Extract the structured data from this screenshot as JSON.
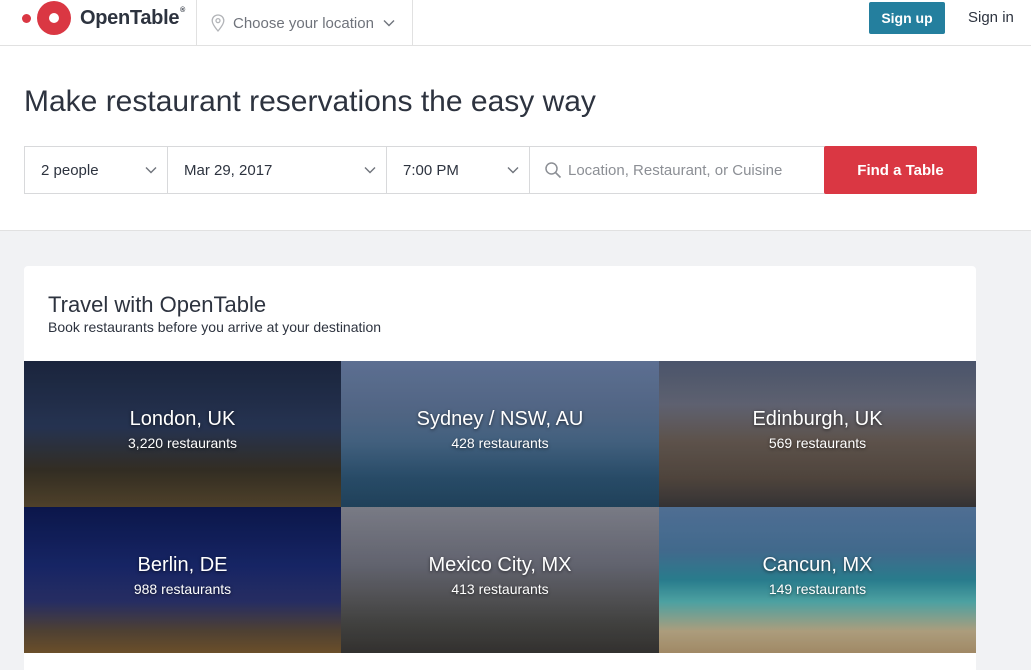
{
  "header": {
    "logo_text": "OpenTable",
    "logo_mark": "®",
    "location_label": "Choose your location",
    "signup_label": "Sign up",
    "signin_label": "Sign in"
  },
  "search": {
    "title": "Make restaurant reservations the easy way",
    "party_size": "2 people",
    "date": "Mar 29, 2017",
    "time": "7:00 PM",
    "query_placeholder": "Location, Restaurant, or Cuisine",
    "find_label": "Find a Table"
  },
  "travel": {
    "title": "Travel with OpenTable",
    "subtitle": "Book restaurants before you arrive at your destination",
    "cities": [
      {
        "name": "London, UK",
        "count": "3,220 restaurants"
      },
      {
        "name": "Sydney / NSW, AU",
        "count": "428 restaurants"
      },
      {
        "name": "Edinburgh, UK",
        "count": "569 restaurants"
      },
      {
        "name": "Berlin, DE",
        "count": "988 restaurants"
      },
      {
        "name": "Mexico City, MX",
        "count": "413 restaurants"
      },
      {
        "name": "Cancun, MX",
        "count": "149 restaurants"
      }
    ]
  },
  "colors": {
    "brand_red": "#da3743",
    "signup_teal": "#247f9e",
    "text": "#2d333f"
  },
  "icons": [
    "location-pin-icon",
    "chevron-down-icon",
    "search-icon"
  ]
}
